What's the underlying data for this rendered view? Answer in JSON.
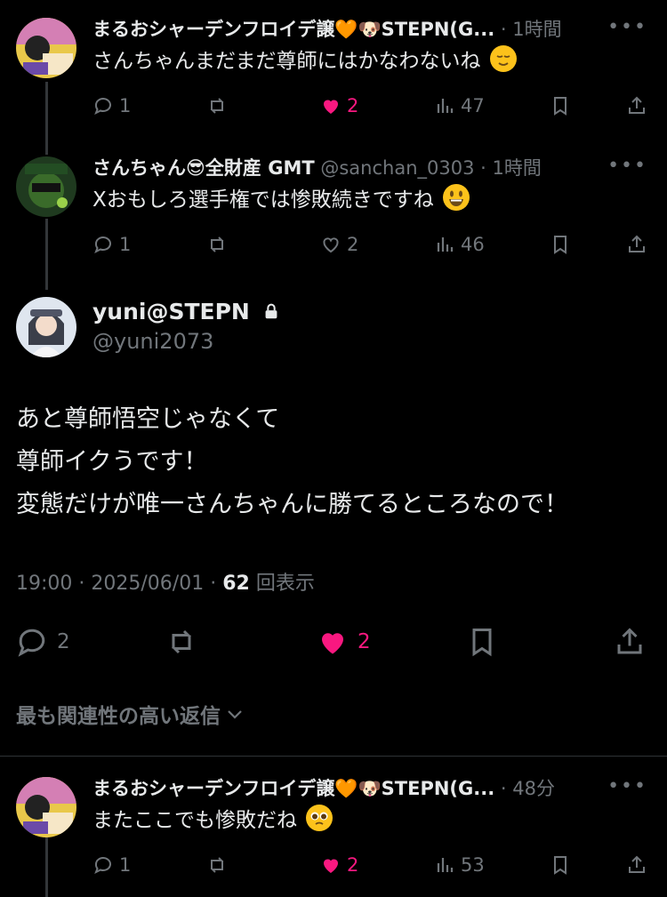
{
  "replies": [
    {
      "name": "まるおシャーデンフロイデ譲🧡🐶STEPN(G...",
      "handle": "",
      "time": "1時間",
      "text": "さんちゃんまだまだ尊師にはかなわないね",
      "emoji": "relieved-face-emoji",
      "stats": {
        "replies": "1",
        "likes": "2",
        "views": "47"
      },
      "liked": true
    },
    {
      "name": "さんちゃん😎全財産 GMT",
      "handle": "@sanchan_0303",
      "time": "1時間",
      "text": "Xおもしろ選手権では惨敗続きですね",
      "emoji": "grinning-face-emoji",
      "stats": {
        "replies": "1",
        "likes": "2",
        "views": "46"
      },
      "liked": false
    }
  ],
  "main_post": {
    "name": "yuni@STEPN",
    "handle": "@yuni2073",
    "lines": [
      "あと尊師悟空じゃなくて",
      "尊師イクうです！",
      "変態だけが唯一さんちゃんに勝てるところなので！"
    ],
    "time": "19:00",
    "date": "2025/06/01",
    "views_count": "62",
    "views_label": "回表示",
    "stats": {
      "replies": "2",
      "likes": "2"
    },
    "liked": true
  },
  "sort_label": "最も関連性の高い返信",
  "bottom_reply": {
    "name": "まるおシャーデンフロイデ譲🧡🐶STEPN(G...",
    "time": "48分",
    "text": "またここでも惨敗だね",
    "emoji": "pleading-face-emoji",
    "stats": {
      "replies": "1",
      "likes": "2",
      "views": "53"
    },
    "liked": true
  },
  "colors": {
    "background": "#000000",
    "text": "#e7e9ea",
    "muted": "#71767b",
    "like": "#f91880"
  }
}
